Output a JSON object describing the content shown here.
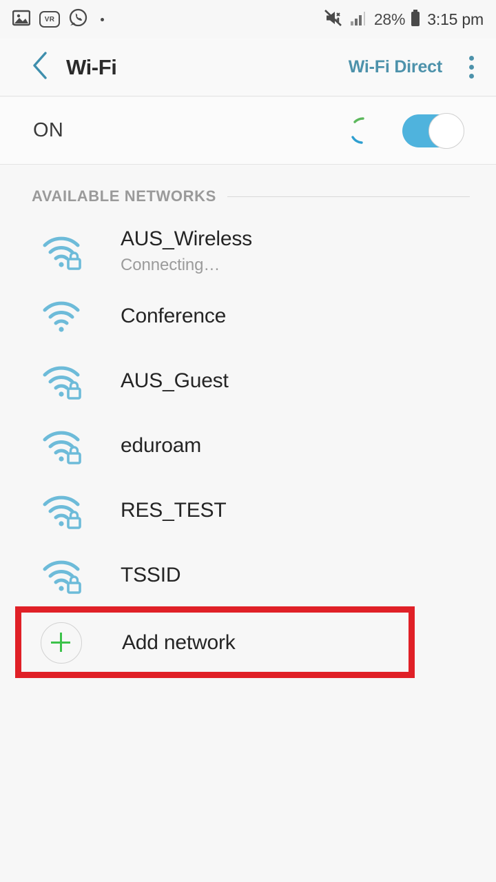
{
  "status_bar": {
    "left_icons": [
      {
        "name": "image-icon",
        "label": "image"
      },
      {
        "name": "vr-icon",
        "label": "VR"
      },
      {
        "name": "whatsapp-icon",
        "label": "whatsapp"
      },
      {
        "name": "more-notifications-dot",
        "label": "·"
      }
    ],
    "mute_icon": "mute-icon",
    "signal_icon": "cellular-signal-icon",
    "battery_percent": "28%",
    "battery_icon": "battery-icon",
    "time": "3:15 pm"
  },
  "app_bar": {
    "back_icon": "back-chevron-icon",
    "title": "Wi-Fi",
    "action_label": "Wi-Fi Direct",
    "overflow_icon": "overflow-menu-icon"
  },
  "wifi_toggle": {
    "state_label": "ON",
    "switch_on": true,
    "scanning": true,
    "accent_color": "#4fb3dd",
    "spinner_colors": [
      "#5cb85c",
      "#2e9fd0"
    ]
  },
  "available_networks": {
    "header": "AVAILABLE NETWORKS",
    "items": [
      {
        "ssid": "AUS_Wireless",
        "status": "Connecting…",
        "secured": true,
        "signal": 3
      },
      {
        "ssid": "Conference",
        "status": "",
        "secured": false,
        "signal": 3
      },
      {
        "ssid": "AUS_Guest",
        "status": "",
        "secured": true,
        "signal": 3
      },
      {
        "ssid": "eduroam",
        "status": "",
        "secured": true,
        "signal": 3
      },
      {
        "ssid": "RES_TEST",
        "status": "",
        "secured": true,
        "signal": 3
      },
      {
        "ssid": "TSSID",
        "status": "",
        "secured": true,
        "signal": 3
      }
    ]
  },
  "add_network": {
    "label": "Add network",
    "icon": "plus-circle-icon",
    "plus_color": "#3cc24a"
  },
  "annotation": {
    "type": "highlight-rectangle",
    "target": "Add network",
    "color": "#e02027"
  },
  "theme": {
    "background": "#f7f7f7",
    "wifi_icon_color": "#6dbbd9",
    "link_color": "#4d92ab",
    "text_primary": "#252525",
    "text_secondary": "#9b9b9b"
  }
}
